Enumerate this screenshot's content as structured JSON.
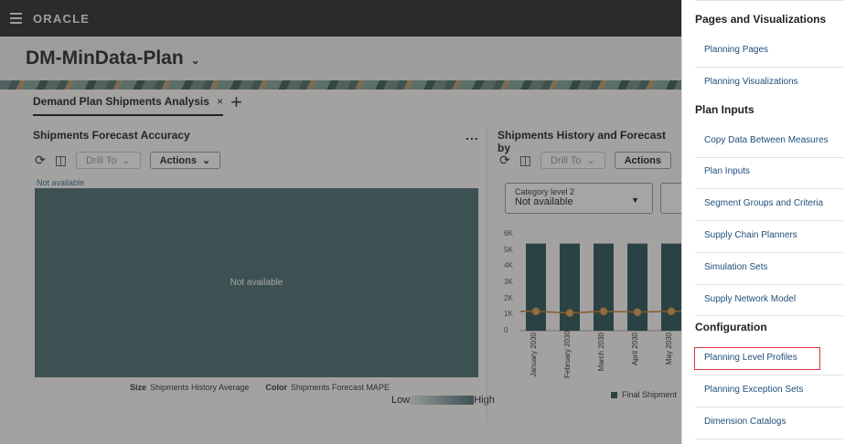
{
  "app": {
    "brand": "ORACLE"
  },
  "plan": {
    "title": "DM-MinData-Plan"
  },
  "tab": {
    "label": "Demand Plan Shipments Analysis",
    "close": "×",
    "add": "+"
  },
  "card1": {
    "title": "Shipments Forecast Accuracy",
    "more": "...",
    "drill_label": "Drill To",
    "actions_label": "Actions",
    "not_available_top": "Not available",
    "not_available_center": "Not available",
    "size_key": "Size",
    "size_value": "Shipments History Average",
    "color_key": "Color",
    "color_value": "Shipments Forecast MAPE",
    "low": "Low",
    "high": "High"
  },
  "card2": {
    "title": "Shipments History and Forecast by",
    "drill_label": "Drill To",
    "actions_label": "Actions",
    "select_label": "Category level 2",
    "select_value": "Not available",
    "legend_label": "Final Shipment"
  },
  "chart_data": {
    "type": "bar",
    "categories": [
      "January 2030",
      "February 2030",
      "March 2030",
      "April 2030",
      "May 2030"
    ],
    "series": [
      {
        "name": "Final Shipment",
        "type": "bar",
        "values": [
          5400,
          5400,
          5400,
          5400,
          5400
        ]
      },
      {
        "type": "line",
        "values": [
          1200,
          1100,
          1200,
          1150,
          1200
        ]
      }
    ],
    "ylim": [
      0,
      6000
    ],
    "yticks": [
      "6K",
      "5K",
      "4K",
      "3K",
      "2K",
      "1K",
      "0"
    ],
    "colors": {
      "bar": "#2e5558",
      "line": "#c9822a",
      "marker": "#d9a05a"
    }
  },
  "panel": {
    "sections": [
      {
        "title": "Pages and Visualizations",
        "items": [
          "Planning Pages",
          "Planning Visualizations"
        ]
      },
      {
        "title": "Plan Inputs",
        "items": [
          "Copy Data Between Measures",
          "Plan Inputs",
          "Segment Groups and Criteria",
          "Supply Chain Planners",
          "Simulation Sets",
          "Supply Network Model"
        ]
      },
      {
        "title": "Configuration",
        "items": [
          "Planning Level Profiles",
          "Planning Exception Sets",
          "Dimension Catalogs"
        ]
      }
    ],
    "highlighted": "Planning Level Profiles",
    "highlight_color": "#d9343a"
  }
}
